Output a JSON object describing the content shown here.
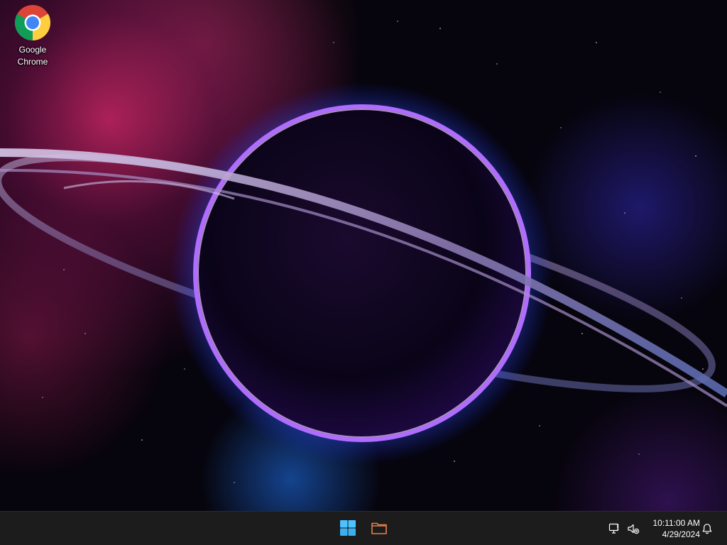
{
  "desktop": {
    "icons": [
      {
        "label": "Google Chrome",
        "icon": "chrome-icon"
      }
    ]
  },
  "taskbar": {
    "center_apps": [
      {
        "name": "Start",
        "icon": "windows-start-icon",
        "accent": "#4cc2ff"
      },
      {
        "name": "File Explorer",
        "icon": "folder-icon",
        "accent": "#e8804a"
      }
    ],
    "tray": {
      "network_icon": "network-disconnected-icon",
      "volume_icon": "volume-muted-icon",
      "time": "10:11:00 AM",
      "date": "4/29/2024",
      "notification_icon": "bell-icon"
    }
  },
  "wallpaper": {
    "subject": "ringed-planet-icon",
    "colors": [
      "#7b2cff",
      "#2a7bff",
      "#e02a7a",
      "#06040c"
    ]
  }
}
